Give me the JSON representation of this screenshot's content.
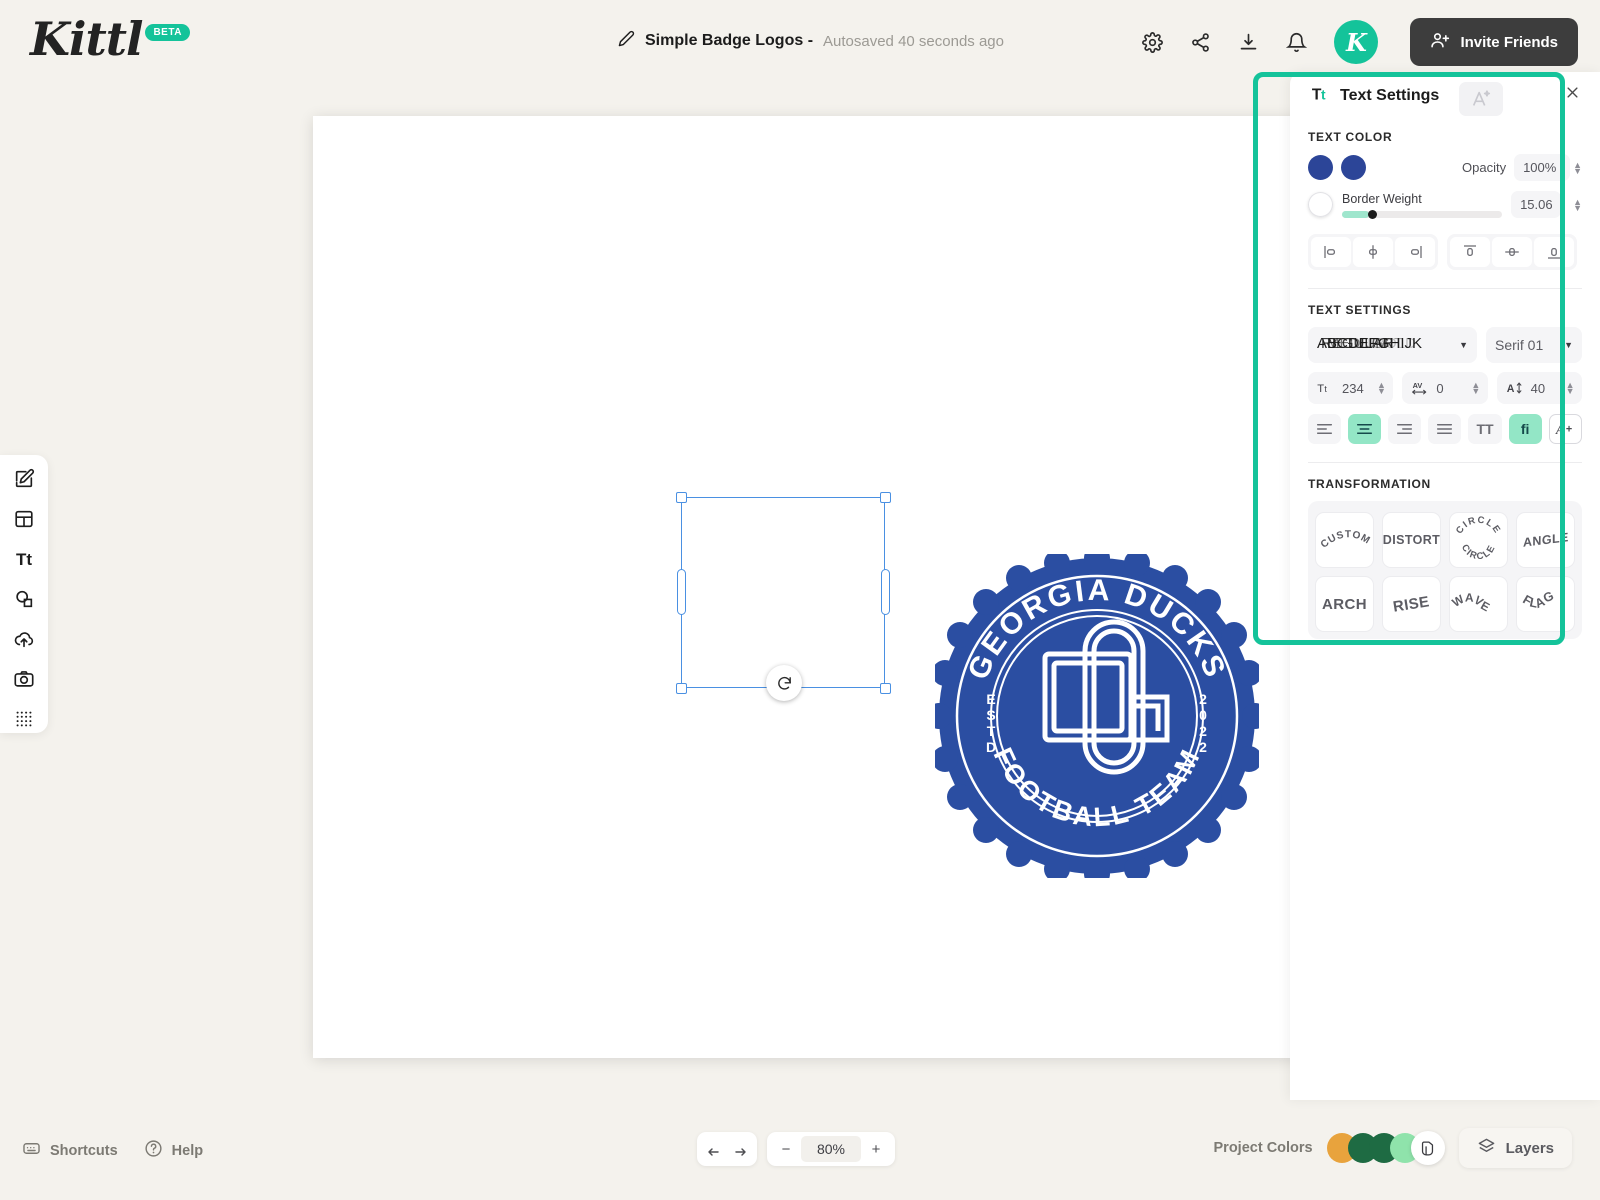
{
  "app": {
    "logo_text": "Kittl",
    "logo_badge": "BETA",
    "brand_accent": "#14c39a"
  },
  "header": {
    "document_title": "Simple Badge Logos -",
    "autosave_status": "Autosaved 40 seconds ago",
    "edit_icon": "pencil-icon",
    "actions": [
      {
        "name": "settings",
        "icon": "gear-icon"
      },
      {
        "name": "share",
        "icon": "share-icon"
      },
      {
        "name": "download",
        "icon": "download-icon"
      },
      {
        "name": "notifications",
        "icon": "bell-icon"
      }
    ],
    "avatar_letter": "K",
    "invite_label": "Invite Friends",
    "invite_icon": "add-person-icon"
  },
  "left_toolbar": {
    "items": [
      {
        "name": "templates",
        "icon": "pencil-square-icon"
      },
      {
        "name": "layouts",
        "icon": "layout-icon"
      },
      {
        "name": "text",
        "icon": "text-Tt-icon"
      },
      {
        "name": "elements",
        "icon": "shapes-icon"
      },
      {
        "name": "uploads",
        "icon": "cloud-upload-icon"
      },
      {
        "name": "photos",
        "icon": "camera-icon"
      },
      {
        "name": "patterns",
        "icon": "grid-dots-icon"
      }
    ]
  },
  "canvas": {
    "badge": {
      "top_arc_text": "GEORGIA DUCKS",
      "bottom_arc_text": "FOOTBALL TEAM",
      "left_text": "ESTD",
      "right_text": "2022",
      "monogram": "GD",
      "badge_color": "#2b4ea2",
      "accent_color": "#ffffff"
    },
    "rotate_icon": "rotate-icon"
  },
  "panel": {
    "title": "Text Settings",
    "title_icon": "Tt-icon",
    "effects_tab_icon": "ai-text-effect-icon",
    "close_icon": "close-icon",
    "text_color": {
      "label": "TEXT COLOR",
      "fill_color": "#2c4598",
      "stroke_color": "#2c4598",
      "border_color": "#ffffff",
      "opacity_label": "Opacity",
      "opacity_value": "100%",
      "border_weight_label": "Border Weight",
      "border_weight_value": "15.06"
    },
    "align_buttons": [
      {
        "name": "align-left",
        "icon": "align-left-icon"
      },
      {
        "name": "align-center-horizontal",
        "icon": "align-center-h-icon"
      },
      {
        "name": "align-right",
        "icon": "align-right-icon"
      },
      {
        "name": "align-top",
        "icon": "align-top-icon"
      },
      {
        "name": "align-middle-vertical",
        "icon": "align-middle-v-icon"
      },
      {
        "name": "align-bottom",
        "icon": "align-bottom-icon"
      }
    ],
    "text_settings": {
      "label": "TEXT SETTINGS",
      "font_family_glitch_layers": [
        "ABCDEFGHIJK",
        "REGULAR",
        "MEDIUM",
        "LIGHT",
        "BOLD"
      ],
      "font_style": "Serif 01",
      "font_size_icon": "font-size-icon",
      "font_size": "234",
      "letter_spacing_icon": "letter-spacing-icon",
      "letter_spacing": "0",
      "line_height_icon": "line-height-icon",
      "line_height": "40",
      "paragraph_buttons": [
        {
          "name": "text-align-left",
          "icon": "text-align-left-icon",
          "active": false
        },
        {
          "name": "text-align-center",
          "icon": "text-align-center-icon",
          "active": true
        },
        {
          "name": "text-align-right",
          "icon": "text-align-right-icon",
          "active": false
        },
        {
          "name": "text-align-justify",
          "icon": "text-align-justify-icon",
          "active": false
        }
      ],
      "uppercase_label": "TT",
      "ligature_label": "fi",
      "auto_fit_label": "A+"
    },
    "transformation": {
      "label": "TRANSFORMATION",
      "options": [
        {
          "label": "CUSTOM",
          "style": "arc"
        },
        {
          "label": "DISTORT",
          "style": "flat"
        },
        {
          "label": "CIRCLE",
          "style": "circle"
        },
        {
          "label": "ANGLE",
          "style": "skew"
        },
        {
          "label": "ARCH",
          "style": "flat"
        },
        {
          "label": "RISE",
          "style": "rise"
        },
        {
          "label": "WAVE",
          "style": "wave"
        },
        {
          "label": "FLAG",
          "style": "flag"
        }
      ]
    }
  },
  "bottom_bar": {
    "shortcuts_label": "Shortcuts",
    "shortcuts_icon": "keyboard-icon",
    "help_label": "Help",
    "help_icon": "question-circle-icon",
    "undo_icon": "undo-arrow-icon",
    "redo_icon": "redo-arrow-icon",
    "zoom_out_label": "−",
    "zoom_value": "80%",
    "zoom_in_label": "+",
    "project_colors_label": "Project Colors",
    "project_colors": [
      "#e8a33d",
      "#1e6b43",
      "#1e6b43",
      "#8fe3ab"
    ],
    "project_colors_more_icon": "palette-icon",
    "layers_label": "Layers",
    "layers_icon": "layers-icon"
  }
}
